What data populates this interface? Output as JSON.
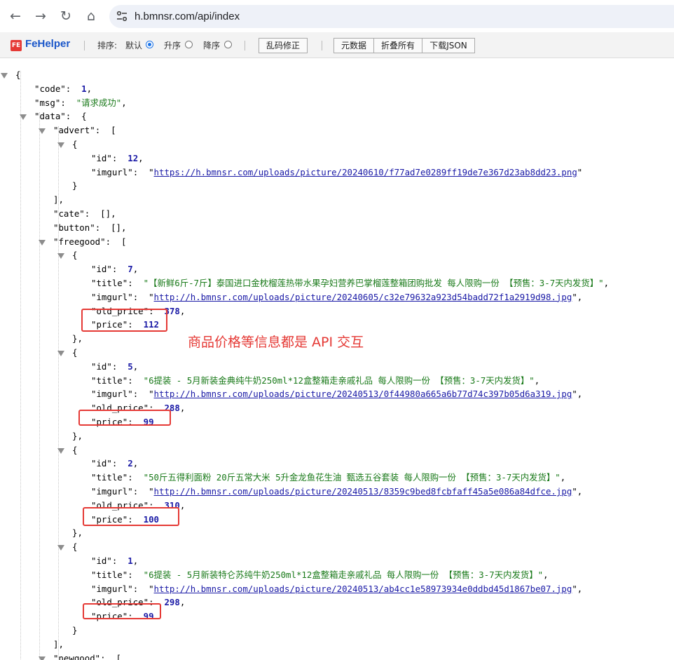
{
  "browser": {
    "url": "h.bmnsr.com/api/index",
    "back_icon": "←",
    "forward_icon": "→",
    "reload_icon": "↻",
    "home_icon": "⌂"
  },
  "toolbar": {
    "logo_mark": "FE",
    "logo_name": "FeHelper",
    "sort_label": "排序:",
    "sort_default": "默认",
    "sort_asc": "升序",
    "sort_desc": "降序",
    "selected_sort": "默认",
    "fix_garbled": "乱码修正",
    "raw_data": "元数据",
    "collapse_all": "折叠所有",
    "download_json": "下载JSON"
  },
  "annotation": "商品价格等信息都是 API 交互",
  "json": {
    "open_brace": "{",
    "code_key": "\"code\"",
    "code_val": "1",
    "msg_key": "\"msg\"",
    "msg_val": "\"请求成功\"",
    "data_key": "\"data\"",
    "advert_key": "\"advert\"",
    "cate_key": "\"cate\"",
    "cate_val": "[]",
    "button_key": "\"button\"",
    "button_val": "[]",
    "freegood_key": "\"freegood\"",
    "newgood_key": "\"newgood\"",
    "advert": [
      {
        "id": "12",
        "imgurl": "https://h.bmnsr.com/uploads/picture/20240610/f77ad7e0289ff19de7e367d23ab8dd23.png"
      }
    ],
    "freegood": [
      {
        "id": "7",
        "title": "\"【新鲜6斤-7斤】泰国进口金枕榴莲热带水果孕妇营养巴掌榴莲整箱团购批发 每人限购一份 【预售：3-7天内发货】\"",
        "imgurl": "http://h.bmnsr.com/uploads/picture/20240605/c32e79632a923d54badd72f1a2919d98.jpg",
        "old_price": "378",
        "price": "112"
      },
      {
        "id": "5",
        "title": "\"6提装 - 5月新装金典纯牛奶250ml*12盒整箱走亲戚礼品 每人限购一份 【预售：3-7天内发货】\"",
        "imgurl": "http://h.bmnsr.com/uploads/picture/20240513/0f44980a665a6b77d74c397b05d6a319.jpg",
        "old_price": "288",
        "price": "99"
      },
      {
        "id": "2",
        "title": "\"50斤五得利面粉 20斤五常大米 5升金龙鱼花生油 甄选五谷套装 每人限购一份 【预售：3-7天内发货】\"",
        "imgurl": "http://h.bmnsr.com/uploads/picture/20240513/8359c9bed8fcbfaff45a5e086a84dfce.jpg",
        "old_price": "310",
        "price": "100"
      },
      {
        "id": "1",
        "title": "\"6提装 - 5月新装特仑苏纯牛奶250ml*12盒整箱走亲戚礼品 每人限购一份 【预售：3-7天内发货】\"",
        "imgurl": "http://h.bmnsr.com/uploads/picture/20240513/ab4cc1e58973934e0ddbd45d1867be07.jpg",
        "old_price": "298",
        "price": "99"
      }
    ]
  }
}
